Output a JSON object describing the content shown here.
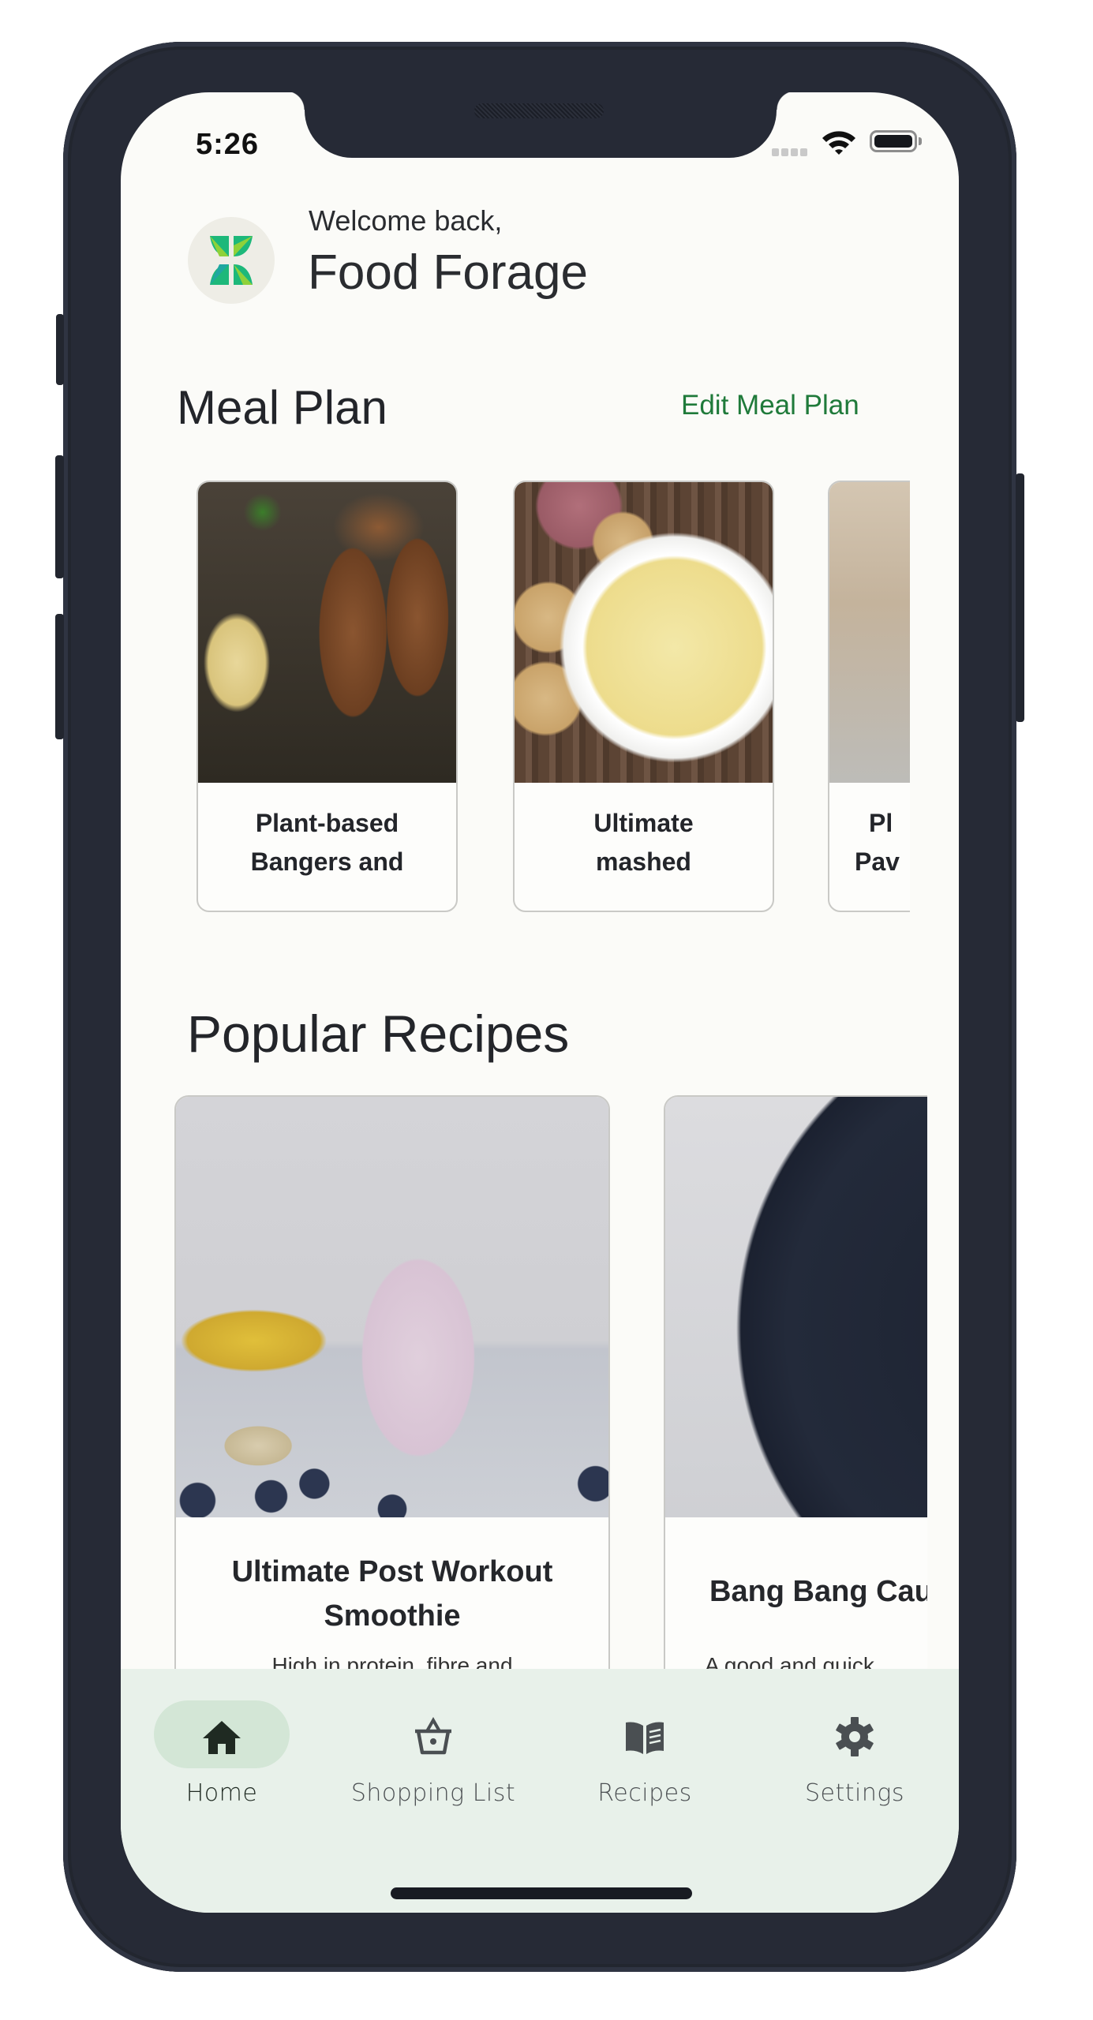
{
  "status_bar": {
    "time": "5:26",
    "signal_icon": "cellular-signal-icon",
    "wifi_icon": "wifi-icon",
    "battery_icon": "battery-icon"
  },
  "header": {
    "logo_icon": "leaf-logo-icon",
    "greeting": "Welcome back,",
    "app_name": "Food Forage"
  },
  "meal_plan": {
    "title": "Meal Plan",
    "edit_label": "Edit Meal Plan",
    "items": [
      {
        "name": "Plant-based Bangers and",
        "image": "sausages-and-mash-photo"
      },
      {
        "name": "Ultimate mashed",
        "image": "mashed-potato-photo"
      },
      {
        "name": "Pl\nPav",
        "image": "pavlova-photo"
      }
    ]
  },
  "popular_recipes": {
    "title": "Popular Recipes",
    "items": [
      {
        "name": "Ultimate Post Workout Smoothie",
        "description": "High in protein, fibre and",
        "image": "smoothie-photo"
      },
      {
        "name": "Bang Bang Cau",
        "description": "A good and quick",
        "image": "bang-bang-cauliflower-photo"
      }
    ]
  },
  "bottom_nav": {
    "items": [
      {
        "label": "Home",
        "icon": "home-icon",
        "active": true
      },
      {
        "label": "Shopping List",
        "icon": "basket-icon",
        "active": false
      },
      {
        "label": "Recipes",
        "icon": "book-icon",
        "active": false
      },
      {
        "label": "Settings",
        "icon": "gear-icon",
        "active": false
      }
    ]
  },
  "colors": {
    "accent": "#1f7a3a",
    "nav_background": "#e8f1ea",
    "nav_active_pill": "#d3e6d6",
    "screen_background": "#fbfbf8",
    "device_frame": "#262a36"
  }
}
